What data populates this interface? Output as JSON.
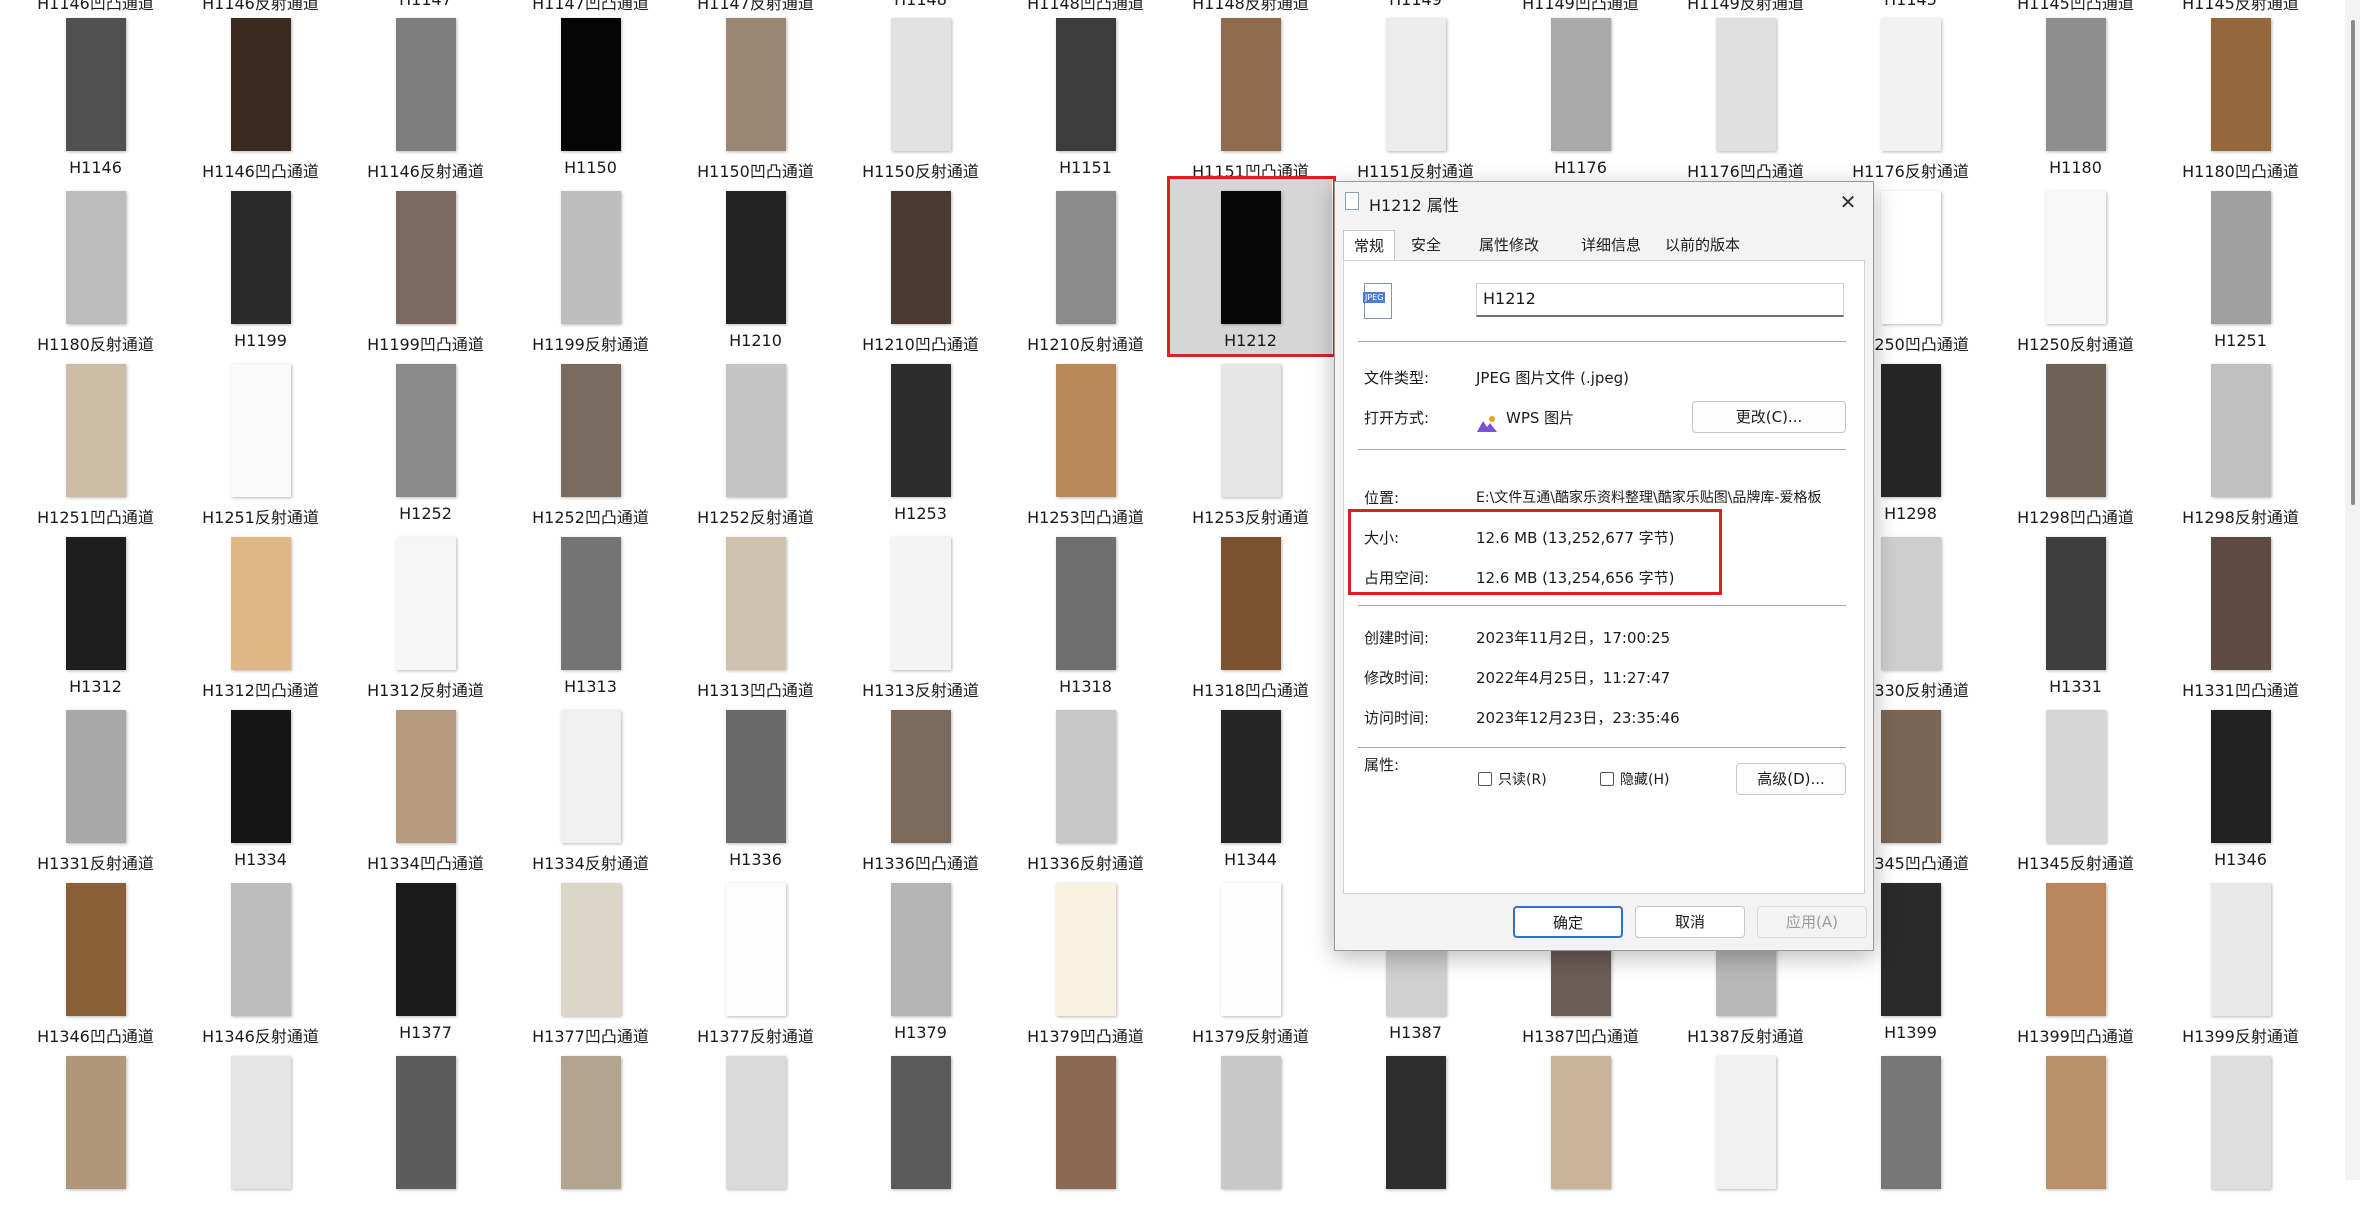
{
  "top_row_labels": [
    "H1146凹凸通道",
    "H1146反射通道",
    "H1147",
    "H1147凹凸通道",
    "H1147反射通道",
    "H1148",
    "H1148凹凸通道",
    "H1148反射通道",
    "H1149",
    "H1149凹凸通道",
    "H1149反射通道",
    "H1145",
    "H1145凹凸通道",
    "H1145反射通道"
  ],
  "rows": [
    [
      "H1146",
      "H1146凹凸通道",
      "H1146反射通道",
      "H1150",
      "H1150凹凸通道",
      "H1150反射通道",
      "H1151",
      "H1151凹凸通道",
      "H1151反射通道",
      "H1176",
      "H1176凹凸通道",
      "H1176反射通道",
      "H1180",
      "H1180凹凸通道"
    ],
    [
      "H1180反射通道",
      "H1199",
      "H1199凹凸通道",
      "H1199反射通道",
      "H1210",
      "H1210凹凸通道",
      "H1210反射通道",
      "H1212",
      "",
      "",
      "",
      "H1250凹凸通道",
      "H1250反射通道",
      "H1251"
    ],
    [
      "H1251凹凸通道",
      "H1251反射通道",
      "H1252",
      "H1252凹凸通道",
      "H1252反射通道",
      "H1253",
      "H1253凹凸通道",
      "H1253反射通道",
      "",
      "",
      "",
      "H1298",
      "H1298凹凸通道",
      "H1298反射通道"
    ],
    [
      "H1312",
      "H1312凹凸通道",
      "H1312反射通道",
      "H1313",
      "H1313凹凸通道",
      "H1313反射通道",
      "H1318",
      "H1318凹凸通道",
      "",
      "",
      "",
      "H1330反射通道",
      "H1331",
      "H1331凹凸通道"
    ],
    [
      "H1331反射通道",
      "H1334",
      "H1334凹凸通道",
      "H1334反射通道",
      "H1336",
      "H1336凹凸通道",
      "H1336反射通道",
      "H1344",
      "",
      "",
      "",
      "H1345凹凸通道",
      "H1345反射通道",
      "H1346"
    ],
    [
      "H1346凹凸通道",
      "H1346反射通道",
      "H1377",
      "H1377凹凸通道",
      "H1377反射通道",
      "H1379",
      "H1379凹凸通道",
      "H1379反射通道",
      "H1387",
      "H1387凹凸通道",
      "H1387反射通道",
      "H1399",
      "H1399凹凸通道",
      "H1399反射通道"
    ]
  ],
  "bottom_row_labels": [
    "",
    "",
    "",
    "",
    "",
    "",
    "",
    "",
    "",
    "",
    "",
    "",
    "",
    ""
  ],
  "dialog": {
    "title": "H1212 属性",
    "close_glyph": "✕",
    "tabs": [
      "常规",
      "安全",
      "属性修改",
      "详细信息",
      "以前的版本"
    ],
    "file_name": "H1212",
    "file_icon_text": "JPEG",
    "type_label": "文件类型:",
    "type_value": "JPEG 图片文件 (.jpeg)",
    "open_label": "打开方式:",
    "open_value": "WPS 图片",
    "change_button": "更改(C)...",
    "location_label": "位置:",
    "location_value": "E:\\文件互通\\酷家乐资料整理\\酷家乐贴图\\品牌库-爱格板",
    "size_label": "大小:",
    "size_value": "12.6 MB (13,252,677 字节)",
    "disk_label": "占用空间:",
    "disk_value": "12.6 MB (13,254,656 字节)",
    "created_label": "创建时间:",
    "created_value": "2023年11月2日，17:00:25",
    "modified_label": "修改时间:",
    "modified_value": "2022年4月25日，11:27:47",
    "accessed_label": "访问时间:",
    "accessed_value": "2023年12月23日，23:35:46",
    "attr_label": "属性:",
    "readonly_label": "只读(R)",
    "hidden_label": "隐藏(H)",
    "advanced_button": "高级(D)...",
    "ok_button": "确定",
    "cancel_button": "取消",
    "apply_button": "应用(A)"
  },
  "colors": {
    "highlight_red": "#e02020",
    "selection": "#d6d6d6",
    "accent": "#2f6fd0"
  }
}
